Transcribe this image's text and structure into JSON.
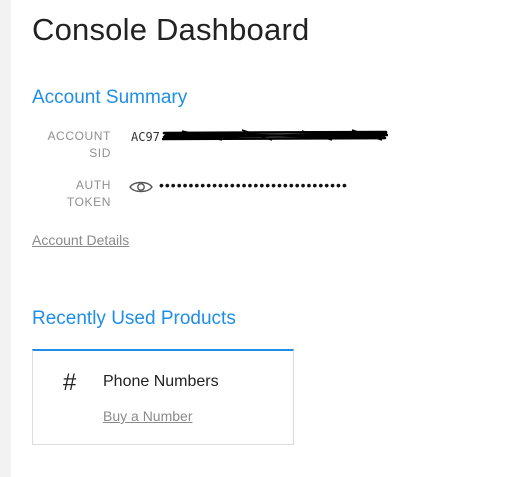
{
  "page": {
    "title": "Console Dashboard"
  },
  "account_summary": {
    "title": "Account Summary",
    "sid": {
      "label_line1": "ACCOUNT",
      "label_line2": "SID",
      "value_visible": "AC97"
    },
    "auth_token": {
      "label_line1": "AUTH",
      "label_line2": "TOKEN",
      "masked_value": "••••••••••••••••••••••••••••••••",
      "icon": "eye-icon"
    },
    "details_link": "Account Details"
  },
  "recent_products": {
    "title": "Recently Used Products",
    "items": [
      {
        "icon": "hash-icon",
        "icon_glyph": "#",
        "name": "Phone Numbers",
        "action": "Buy a Number"
      }
    ]
  },
  "colors": {
    "accent": "#1f8ee6",
    "text": "#222222",
    "muted": "#8f8f8f"
  }
}
